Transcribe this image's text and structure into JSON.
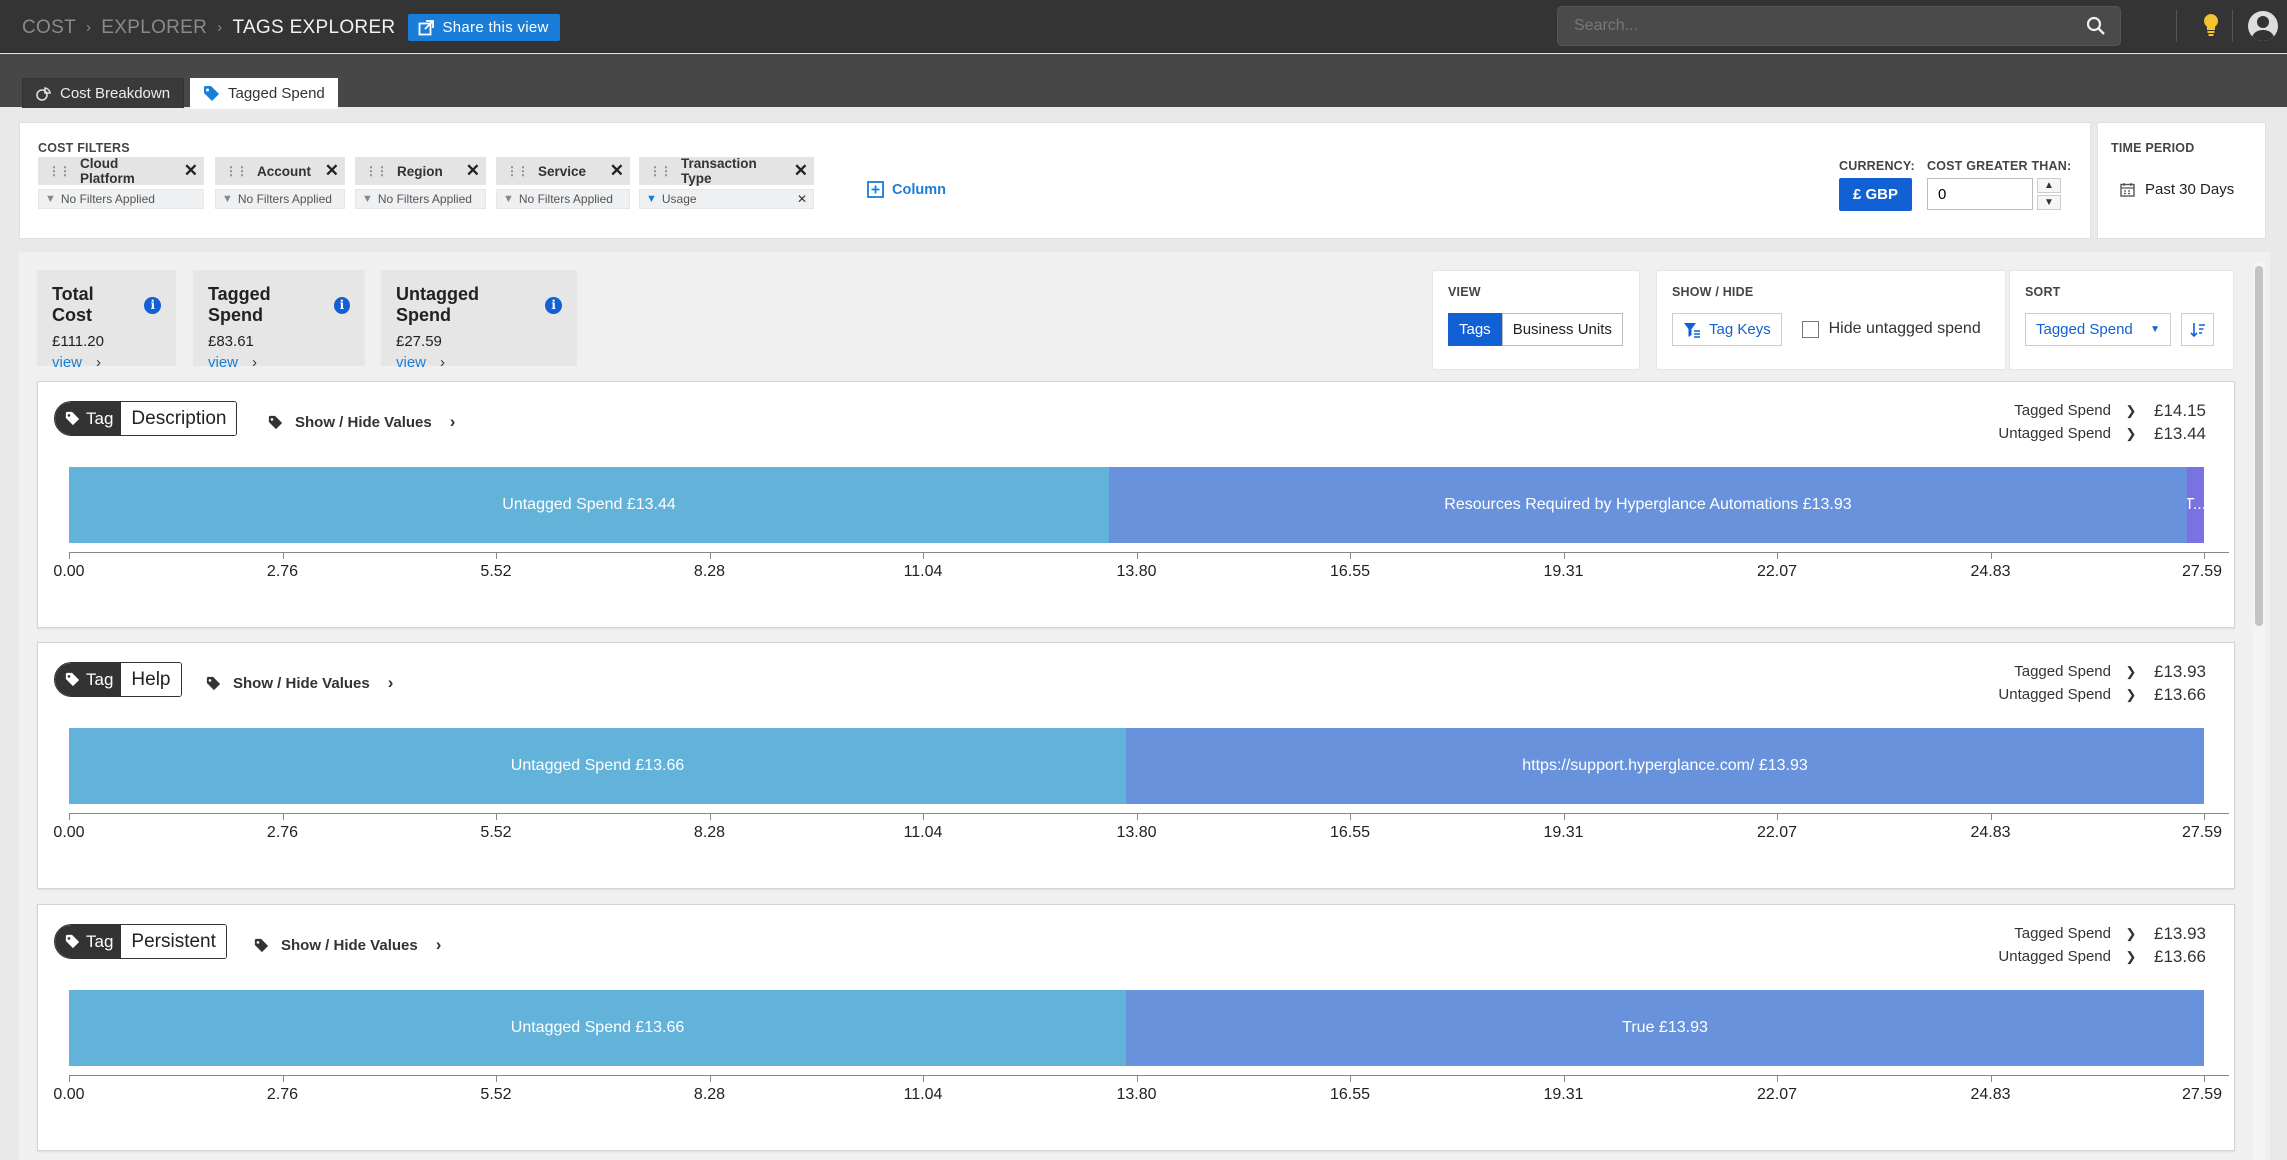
{
  "header": {
    "breadcrumbs": [
      "COST",
      "EXPLORER",
      "TAGS EXPLORER"
    ],
    "share_label": "Share this view",
    "search_placeholder": "Search...",
    "icons": [
      "external-link-icon",
      "search-icon",
      "lightbulb-icon",
      "user-icon"
    ]
  },
  "tabs": [
    {
      "label": "Cost Breakdown",
      "icon": "cost-breakdown-icon",
      "active": false
    },
    {
      "label": "Tagged Spend",
      "icon": "tag-icon",
      "active": true
    }
  ],
  "filters": {
    "title": "COST FILTERS",
    "chips": [
      {
        "label": "Cloud Platform",
        "value": "No Filters Applied"
      },
      {
        "label": "Account",
        "value": "No Filters Applied"
      },
      {
        "label": "Region",
        "value": "No Filters Applied"
      },
      {
        "label": "Service",
        "value": "No Filters Applied"
      },
      {
        "label": "Transaction Type",
        "value": "Usage"
      }
    ],
    "add_column_label": "Column",
    "currency_label": "CURRENCY:",
    "currency_value": "£ GBP",
    "cost_gt_label": "COST GREATER THAN:",
    "cost_gt_value": "0",
    "time_period_label": "TIME PERIOD",
    "time_period_value": "Past 30 Days"
  },
  "stats": [
    {
      "title": "Total Cost",
      "value": "£111.20",
      "link": "view"
    },
    {
      "title": "Tagged Spend",
      "value": "£83.61",
      "link": "view"
    },
    {
      "title": "Untagged Spend",
      "value": "£27.59",
      "link": "view"
    }
  ],
  "view": {
    "label": "VIEW",
    "options": [
      "Tags",
      "Business Units"
    ],
    "selected": "Tags"
  },
  "show_hide": {
    "label": "SHOW / HIDE",
    "tag_keys_label": "Tag Keys",
    "hide_untagged_label": "Hide untagged spend",
    "hide_untagged_checked": false
  },
  "sort": {
    "label": "SORT",
    "selected": "Tagged Spend"
  },
  "colors": {
    "untagged": "#63b2da",
    "tagged": "#6893dc",
    "tagged_small": "#7a72e0",
    "accent": "#1160d4",
    "link": "#1a7ed8"
  },
  "card_common": {
    "tag_word": "Tag",
    "show_hide_values": "Show / Hide Values",
    "tagged_label": "Tagged Spend",
    "untagged_label": "Untagged Spend"
  },
  "chart_data": [
    {
      "type": "bar",
      "orientation": "horizontal-stacked",
      "tag": "Description",
      "legend": {
        "tagged": "£14.15",
        "untagged": "£13.44"
      },
      "x_ticks": [
        "0.00",
        "2.76",
        "5.52",
        "8.28",
        "11.04",
        "13.80",
        "16.55",
        "19.31",
        "22.07",
        "24.83",
        "27.59"
      ],
      "xlim": [
        0,
        27.59
      ],
      "segments": [
        {
          "label": "Untagged Spend £13.44",
          "value": 13.44,
          "color": "#63b2da"
        },
        {
          "label": "Resources Required by Hyperglance Automations £13.93",
          "value": 13.93,
          "color": "#6893dc"
        },
        {
          "label": "T...",
          "value": 0.22,
          "color": "#7a72e0"
        }
      ]
    },
    {
      "type": "bar",
      "orientation": "horizontal-stacked",
      "tag": "Help",
      "legend": {
        "tagged": "£13.93",
        "untagged": "£13.66"
      },
      "x_ticks": [
        "0.00",
        "2.76",
        "5.52",
        "8.28",
        "11.04",
        "13.80",
        "16.55",
        "19.31",
        "22.07",
        "24.83",
        "27.59"
      ],
      "xlim": [
        0,
        27.59
      ],
      "segments": [
        {
          "label": "Untagged Spend £13.66",
          "value": 13.66,
          "color": "#63b2da"
        },
        {
          "label": "https://support.hyperglance.com/ £13.93",
          "value": 13.93,
          "color": "#6893dc"
        }
      ]
    },
    {
      "type": "bar",
      "orientation": "horizontal-stacked",
      "tag": "Persistent",
      "legend": {
        "tagged": "£13.93",
        "untagged": "£13.66"
      },
      "x_ticks": [
        "0.00",
        "2.76",
        "5.52",
        "8.28",
        "11.04",
        "13.80",
        "16.55",
        "19.31",
        "22.07",
        "24.83",
        "27.59"
      ],
      "xlim": [
        0,
        27.59
      ],
      "segments": [
        {
          "label": "Untagged Spend £13.66",
          "value": 13.66,
          "color": "#63b2da"
        },
        {
          "label": "True £13.93",
          "value": 13.93,
          "color": "#6893dc"
        }
      ]
    }
  ]
}
